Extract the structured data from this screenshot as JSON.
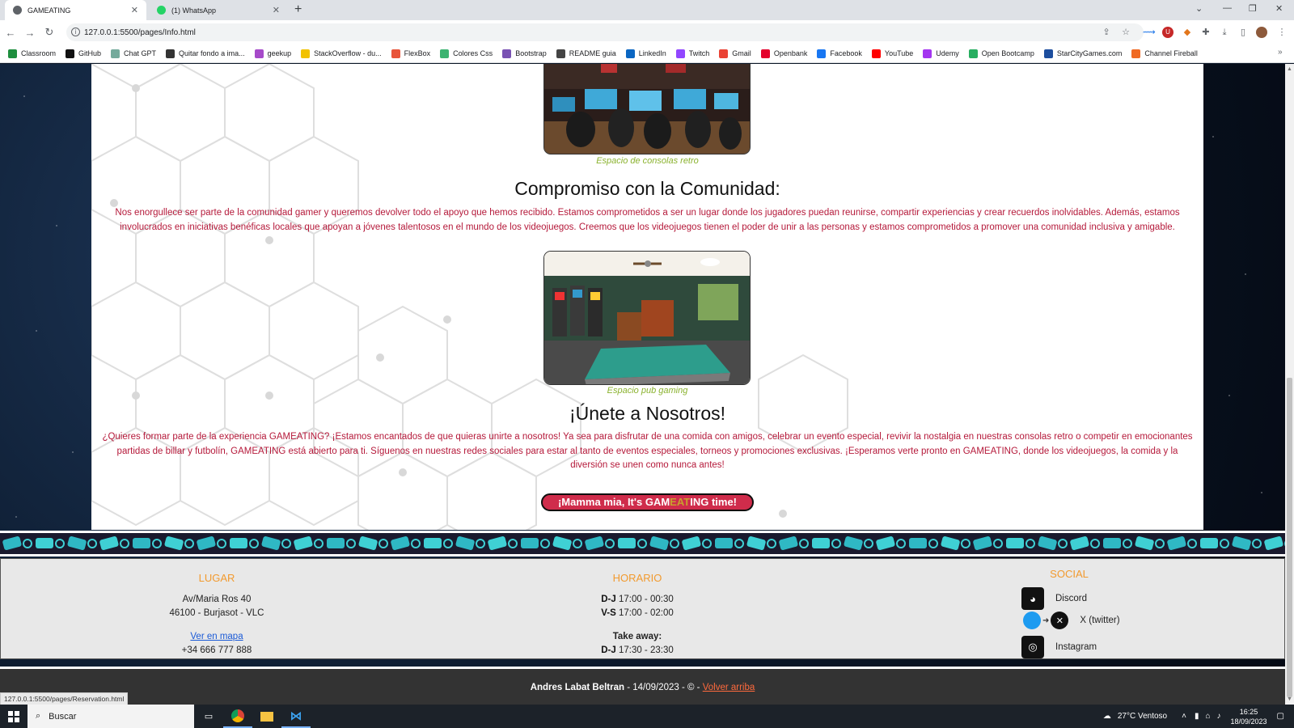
{
  "browser": {
    "tabs": [
      {
        "title": "GAMEATING",
        "active": true
      },
      {
        "title": "(1) WhatsApp",
        "active": false
      }
    ],
    "url": "127.0.0.1:5500/pages/Info.html",
    "bookmarks": [
      {
        "label": "Classroom",
        "icon": "classroom-icon",
        "color": "#1e8e3e"
      },
      {
        "label": "GitHub",
        "icon": "github-icon",
        "color": "#111111"
      },
      {
        "label": "Chat GPT",
        "icon": "chatgpt-icon",
        "color": "#74aa9c"
      },
      {
        "label": "Quitar fondo a ima...",
        "icon": "removebg-icon",
        "color": "#333333"
      },
      {
        "label": "geekup",
        "icon": "geekup-icon",
        "color": "#a64ac9"
      },
      {
        "label": "StackOverflow - du...",
        "icon": "stackoverflow-icon",
        "color": "#f2c200"
      },
      {
        "label": "FlexBox",
        "icon": "flexbox-icon",
        "color": "#e8543a"
      },
      {
        "label": "Colores Css",
        "icon": "colores-icon",
        "color": "#3cb371"
      },
      {
        "label": "Bootstrap",
        "icon": "bootstrap-icon",
        "color": "#7952b3"
      },
      {
        "label": "README guia",
        "icon": "readme-icon",
        "color": "#444444"
      },
      {
        "label": "LinkedIn",
        "icon": "linkedin-icon",
        "color": "#0a66c2"
      },
      {
        "label": "Twitch",
        "icon": "twitch-icon",
        "color": "#9146ff"
      },
      {
        "label": "Gmail",
        "icon": "gmail-icon",
        "color": "#ea4335"
      },
      {
        "label": "Openbank",
        "icon": "openbank-icon",
        "color": "#e4002b"
      },
      {
        "label": "Facebook",
        "icon": "facebook-icon",
        "color": "#1877f2"
      },
      {
        "label": "YouTube",
        "icon": "youtube-icon",
        "color": "#ff0000"
      },
      {
        "label": "Udemy",
        "icon": "udemy-icon",
        "color": "#a435f0"
      },
      {
        "label": "Open Bootcamp",
        "icon": "openbootcamp-icon",
        "color": "#27ae60"
      },
      {
        "label": "StarCityGames.com",
        "icon": "starcity-icon",
        "color": "#1d4e9e"
      },
      {
        "label": "Channel Fireball",
        "icon": "channelfireball-icon",
        "color": "#f06a24"
      }
    ],
    "status_url": "127.0.0.1:5500/pages/Reservation.html"
  },
  "page": {
    "caption_retro": "Espacio de consolas retro",
    "community": {
      "title": "Compromiso con la Comunidad:",
      "text": "Nos enorgullece ser parte de la comunidad gamer y queremos devolver todo el apoyo que hemos recibido. Estamos comprometidos a ser un lugar donde los jugadores puedan reunirse, compartir experiencias y crear recuerdos inolvidables. Además, estamos involucrados en iniciativas benéficas locales que apoyan a jóvenes talentosos en el mundo de los videojuegos. Creemos que los videojuegos tienen el poder de unir a las personas y estamos comprometidos a promover una comunidad inclusiva y amigable."
    },
    "caption_pub": "Espacio pub gaming",
    "join": {
      "title": "¡Únete a Nosotros!",
      "text": "¿Quieres formar parte de la experiencia GAMEATING? ¡Estamos encantados de que quieras unirte a nosotros! Ya sea para disfrutar de una comida con amigos, celebrar un evento especial, revivir la nostalgia en nuestras consolas retro o competir en emocionantes partidas de billar y futbolín, GAMEATING está abierto para ti. Síguenos en nuestras redes sociales para estar al tanto de eventos especiales, torneos y promociones exclusivas. ¡Esperamos verte pronto en GAMEATING, donde los videojuegos, la comida y la diversión se unen como nunca antes!"
    },
    "cta": {
      "pre": "¡Mamma mia, It's ",
      "gam": "GAM",
      "eat": "EAT",
      "ing": "ING",
      "post": " time!"
    }
  },
  "footer": {
    "lugar": {
      "title": "LUGAR",
      "address1": "Av/Maria Ros 40",
      "address2": "46100 - Burjasot - VLC",
      "map_link": "Ver en mapa",
      "phone": "+34 666 777 888"
    },
    "horario": {
      "title": "HORARIO",
      "row1_days": "D-J",
      "row1_hours": " 17:00 - 00:30",
      "row2_days": "V-S",
      "row2_hours": " 17:00 - 02:00",
      "takeaway_label": "Take away:",
      "row3_days": "D-J",
      "row3_hours": " 17:30 - 23:30"
    },
    "social": {
      "title": "SOCIAL",
      "items": [
        {
          "label": "Discord",
          "icon": "discord-icon"
        },
        {
          "label": "X (twitter)",
          "icon": "twitter-x-icon"
        },
        {
          "label": "Instagram",
          "icon": "instagram-icon"
        }
      ]
    },
    "credits": {
      "author": "Andres Labat Beltran",
      "rest": " - 14/09/2023 - © - ",
      "back_top": "Volver arriba"
    }
  },
  "taskbar": {
    "search_placeholder": "Buscar",
    "weather": "27°C  Ventoso",
    "time": "16:25",
    "date": "18/09/2023"
  },
  "colors": {
    "accent_red": "#b5193a",
    "caption_green": "#8ab22e",
    "footer_orange": "#f29a2e",
    "cta_red": "#cf2c4b"
  }
}
